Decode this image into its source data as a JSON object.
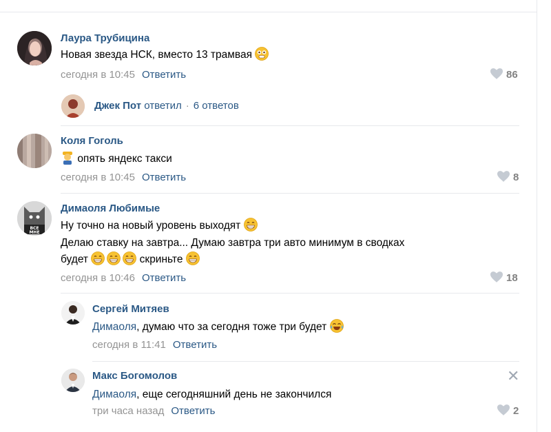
{
  "comments": [
    {
      "name": "Лаура Трубицина",
      "text": "Новая звезда НСК, вместо 13 трамвая",
      "time": "сегодня в 10:45",
      "reply": "Ответить",
      "likes": "86",
      "thread": {
        "name": "Джек Пот",
        "action": "ответил",
        "count": "6 ответов"
      }
    },
    {
      "name": "Коля Гоголь",
      "text": "опять яндекс такси",
      "time": "сегодня в 10:45",
      "reply": "Ответить",
      "likes": "8"
    },
    {
      "name": "Димаоля Любимые",
      "line1": "Ну точно на новый уровень выходят",
      "line2": "Делаю ставку на завтра... Думаю завтра три авто минимум в сводках",
      "line3a": "будет",
      "line3b": "скриньте",
      "time": "сегодня в 10:46",
      "reply": "Ответить",
      "likes": "18",
      "avatar_text_top": "ВСЕ",
      "avatar_text_bottom": "МНЕ"
    }
  ],
  "replies": [
    {
      "name": "Сергей Митяев",
      "mention": "Димаоля",
      "text": ", думаю что за сегодня тоже три будет",
      "time": "сегодня в 11:41",
      "reply": "Ответить"
    },
    {
      "name": "Макс Богомолов",
      "mention": "Димаоля",
      "text": ", еще сегодняшний день не закончился",
      "time": "три часа назад",
      "reply": "Ответить",
      "likes": "2",
      "close_glyph": "✕"
    }
  ],
  "colors": {
    "link": "#2a5885",
    "meta": "#939393",
    "like": "#828282",
    "divider": "#e7e8ec"
  }
}
